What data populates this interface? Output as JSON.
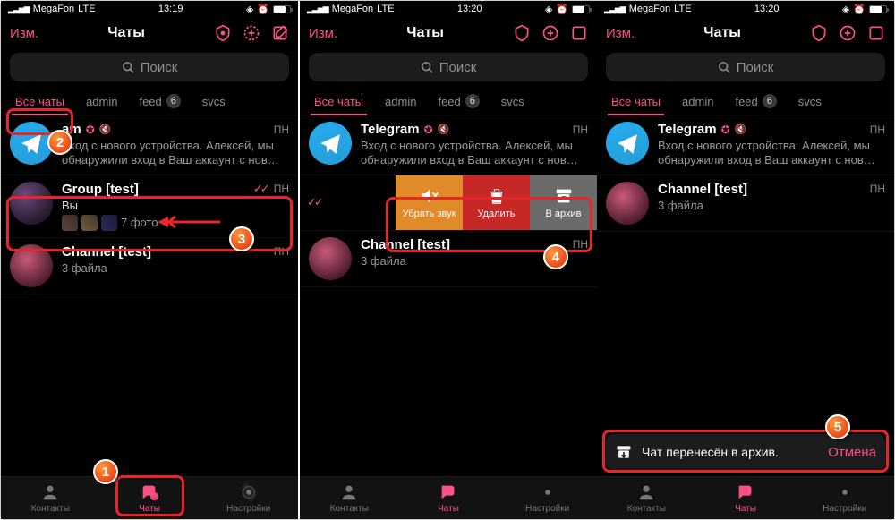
{
  "status": {
    "carrier": "MegaFon",
    "net": "LTE",
    "t1": "13:19",
    "t2": "13:20",
    "t3": "13:20"
  },
  "header": {
    "edit": "Изм.",
    "title": "Чаты"
  },
  "search": {
    "placeholder": "Поиск"
  },
  "folders": {
    "all": "Все чаты",
    "admin": "admin",
    "feed": "feed",
    "feed_badge": "6",
    "svcs": "svcs"
  },
  "chats": {
    "telegram": {
      "name": "Telegram",
      "partial_name": "am",
      "time": "ПН",
      "msg": "Вход с нового устройства. Алексей, мы обнаружили вход в Ваш аккаунт с нов…"
    },
    "group": {
      "name": "Group [test]",
      "time": "ПН",
      "you": "Вы",
      "photos": "7 фото"
    },
    "channel": {
      "name": "Channel [test]",
      "time": "ПН",
      "sub": "3 файла"
    }
  },
  "swipe": {
    "mute": "Убрать звук",
    "delete": "Удалить",
    "archive": "В архив"
  },
  "toast": {
    "text": "Чат перенесён в архив.",
    "cancel": "Отмена"
  },
  "tabs": {
    "contacts": "Контакты",
    "chats": "Чаты",
    "settings": "Настройки"
  },
  "callouts": {
    "n1": "1",
    "n2": "2",
    "n3": "3",
    "n4": "4",
    "n5": "5"
  }
}
